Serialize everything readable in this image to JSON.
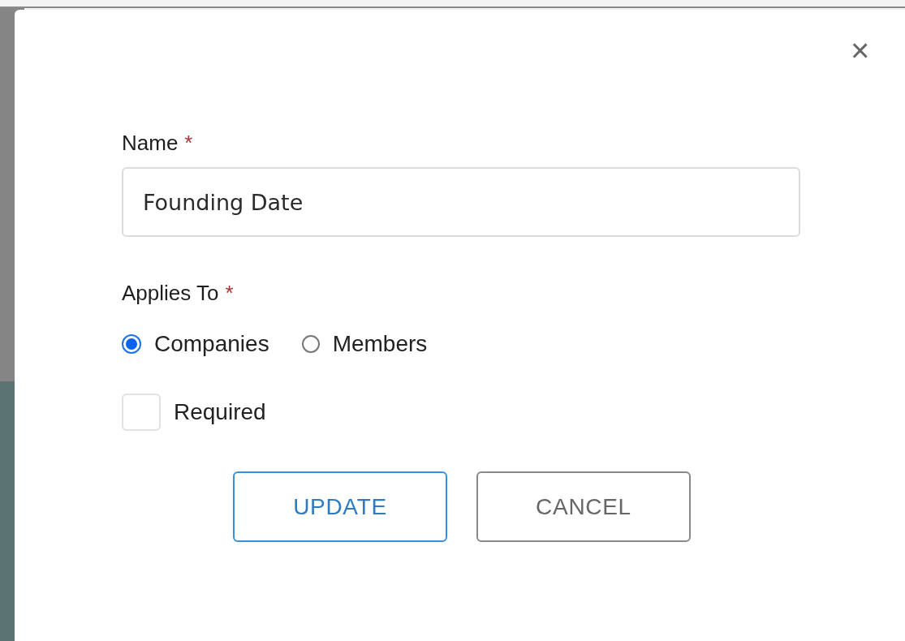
{
  "dialog": {
    "close": "×",
    "name_field": {
      "label": "Name",
      "required_mark": "*",
      "value": "Founding Date"
    },
    "applies_to": {
      "label": "Applies To",
      "required_mark": "*",
      "options": [
        {
          "label": "Companies",
          "selected": true
        },
        {
          "label": "Members",
          "selected": false
        }
      ]
    },
    "required_checkbox": {
      "label": "Required",
      "checked": false
    },
    "buttons": [
      {
        "label": "UPDATE",
        "kind": "primary"
      },
      {
        "label": "CANCEL",
        "kind": "secondary"
      }
    ]
  }
}
